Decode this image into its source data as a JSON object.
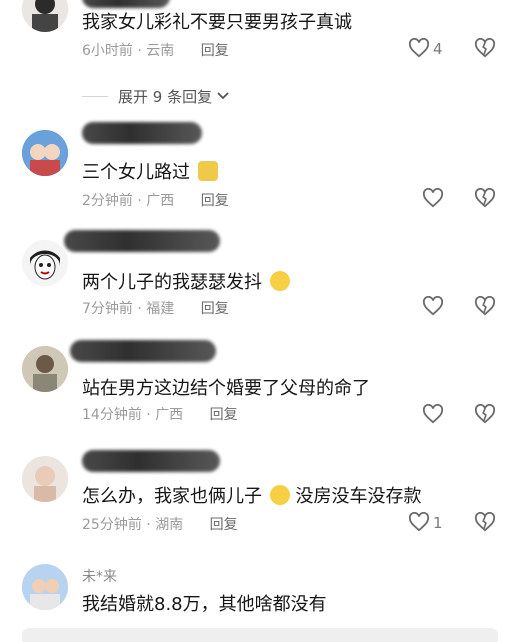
{
  "comments": [
    {
      "text": "我家女儿彩礼不要只要男孩子真诚",
      "time": "6小时前",
      "location": "云南",
      "reply_label": "回复",
      "likes": "4"
    },
    {
      "text": "三个女儿路过",
      "time": "2分钟前",
      "location": "广西",
      "reply_label": "回复",
      "likes": ""
    },
    {
      "text": "两个儿子的我瑟瑟发抖",
      "time": "7分钟前",
      "location": "福建",
      "reply_label": "回复",
      "likes": ""
    },
    {
      "text": "站在男方这边结个婚要了父母的命了",
      "time": "14分钟前",
      "location": "广西",
      "reply_label": "回复",
      "likes": ""
    },
    {
      "text_a": "怎么办，我家也俩儿子",
      "text_b": "没房没车没存款",
      "time": "25分钟前",
      "location": "湖南",
      "reply_label": "回复",
      "likes": "1"
    },
    {
      "username": "未*来",
      "text": "我结婚就8.8万，其他啥都没有"
    }
  ],
  "expand_replies": {
    "label": "展开 9 条回复",
    "icon": "chevron-down-icon"
  },
  "separator": "·",
  "colors": {
    "text": "#161616",
    "meta": "#9b9b9b",
    "icon": "#6b6b6b"
  }
}
